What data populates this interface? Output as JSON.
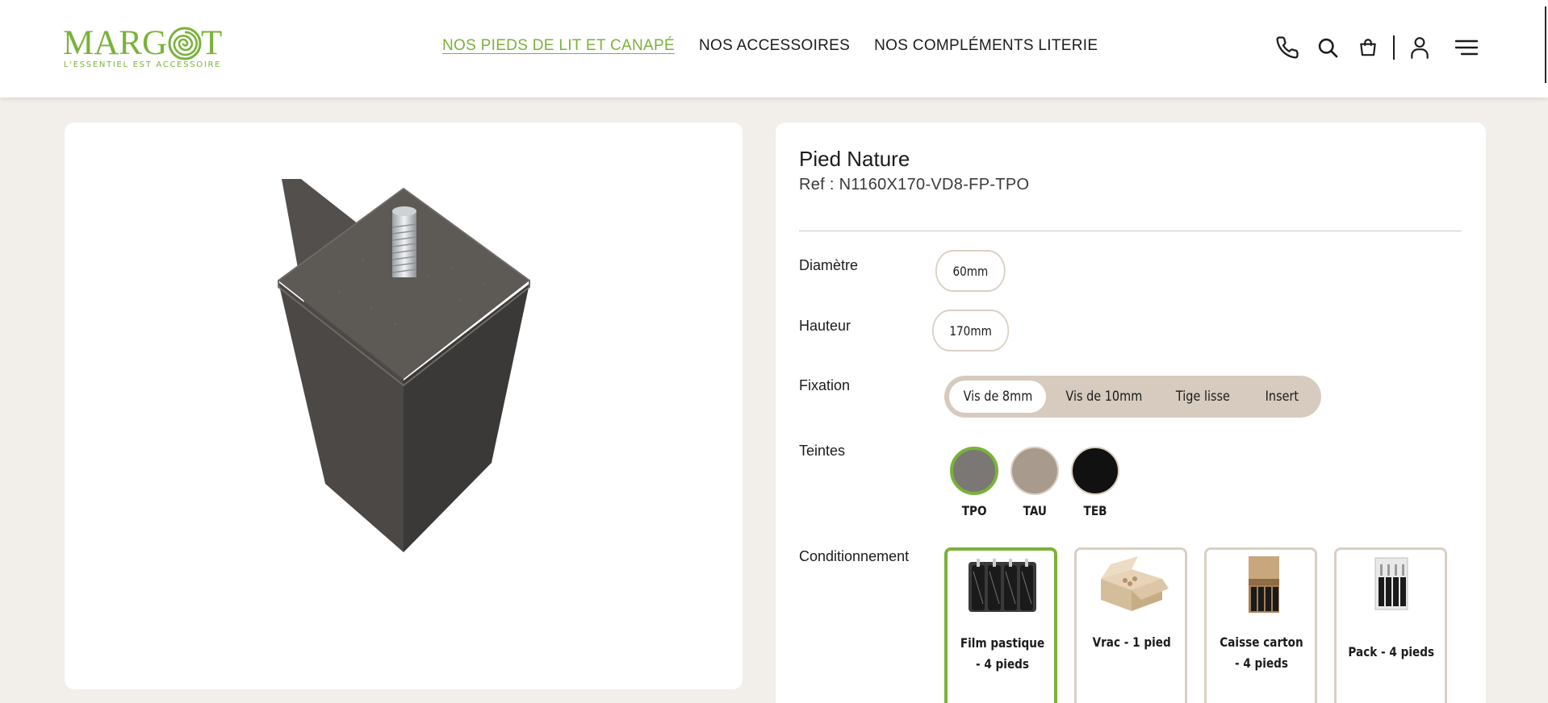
{
  "brand": {
    "name": "MARG",
    "tagline": "L'ESSENTIEL EST ACCESSOIRE",
    "accent": "#7ab23a"
  },
  "nav": [
    {
      "label": "NOS PIEDS DE LIT ET CANAPÉ",
      "active": true
    },
    {
      "label": "NOS ACCESSOIRES",
      "active": false
    },
    {
      "label": "NOS COMPLÉMENTS LITERIE",
      "active": false
    }
  ],
  "header_icons": [
    "phone-icon",
    "search-icon",
    "bag-icon",
    "user-icon",
    "menu-icon"
  ],
  "product": {
    "title": "Pied Nature",
    "ref": "Ref : N1160X170-VD8-FP-TPO"
  },
  "options": {
    "diametre": {
      "label": "Diamètre",
      "value": "60mm"
    },
    "hauteur": {
      "label": "Hauteur",
      "value": "170mm"
    },
    "fixation": {
      "label": "Fixation",
      "items": [
        "Vis de 8mm",
        "Vis de 10mm",
        "Tige lisse",
        "Insert"
      ],
      "selected": "Vis de 8mm"
    },
    "teintes": {
      "label": "Teintes",
      "items": [
        {
          "code": "TPO",
          "color": "#7b7774",
          "selected": true
        },
        {
          "code": "TAU",
          "color": "#a89a8c",
          "selected": false
        },
        {
          "code": "TEB",
          "color": "#111111",
          "selected": false
        }
      ]
    },
    "conditionnement": {
      "label": "Conditionnement",
      "items": [
        {
          "label": "Film pastique - 4 pieds",
          "selected": true
        },
        {
          "label": "Vrac - 1 pied",
          "selected": false
        },
        {
          "label": "Caisse carton - 4 pieds",
          "selected": false
        },
        {
          "label": "Pack - 4 pieds",
          "selected": false
        }
      ]
    }
  }
}
